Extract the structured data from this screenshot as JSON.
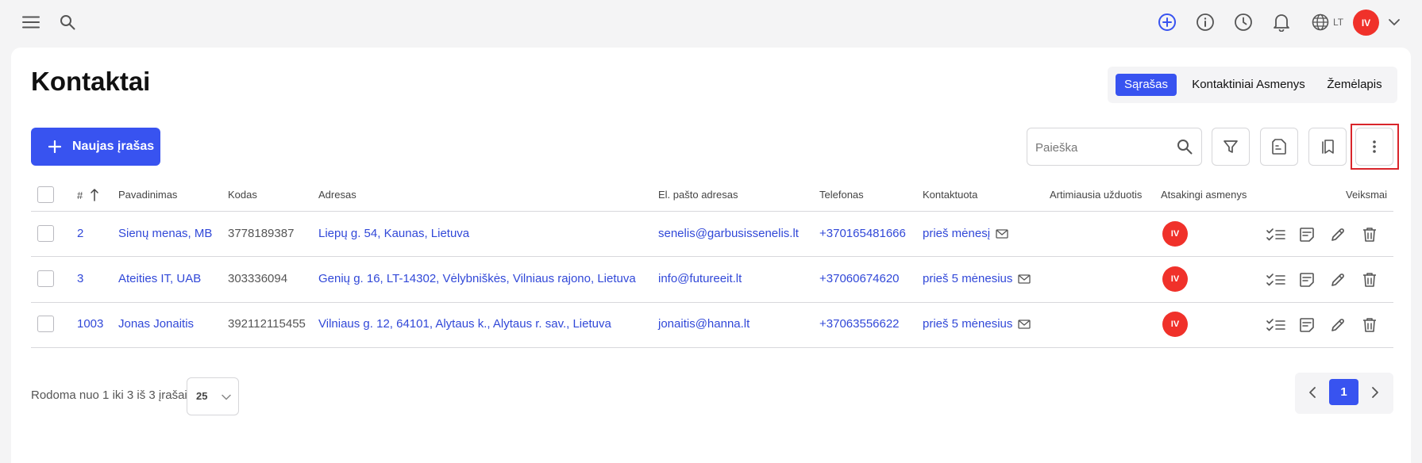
{
  "header": {
    "language": "LT",
    "user_initials": "IV"
  },
  "page": {
    "title": "Kontaktai"
  },
  "view_tabs": [
    {
      "label": "Sąrašas",
      "active": true
    },
    {
      "label": "Kontaktiniai Asmenys",
      "active": false
    },
    {
      "label": "Žemėlapis",
      "active": false
    }
  ],
  "toolbar": {
    "new_record_label": "Naujas įrašas",
    "search_placeholder": "Paieška"
  },
  "table": {
    "columns": [
      "#",
      "Pavadinimas",
      "Kodas",
      "Adresas",
      "El. pašto adresas",
      "Telefonas",
      "Kontaktuota",
      "Artimiausia užduotis",
      "Atsakingi asmenys",
      "Veiksmai"
    ],
    "rows": [
      {
        "id": "2",
        "name": "Sienų menas, MB",
        "code": "3778189387",
        "address": "Liepų g. 54, Kaunas, Lietuva",
        "email": "senelis@garbusissenelis.lt",
        "phone": "+370165481666",
        "contacted": "prieš mėnesį",
        "next_task": "",
        "responsible": "IV"
      },
      {
        "id": "3",
        "name": "Ateities IT, UAB",
        "code": "303336094",
        "address": "Genių g. 16, LT-14302, Vėlybniškės, Vilniaus rajono, Lietuva",
        "email": "info@futureeit.lt",
        "phone": "+37060674620",
        "contacted": "prieš 5 mėnesius",
        "next_task": "",
        "responsible": "IV"
      },
      {
        "id": "1003",
        "name": "Jonas Jonaitis",
        "code": "392112115455",
        "address": "Vilniaus g. 12, 64101, Alytaus k., Alytaus r. sav., Lietuva",
        "email": "jonaitis@hanna.lt",
        "phone": "+37063556622",
        "contacted": "prieš 5 mėnesius",
        "next_task": "",
        "responsible": "IV"
      }
    ]
  },
  "footer": {
    "summary": "Rodoma nuo 1 iki 3 iš 3 įrašai",
    "page_size": "25",
    "current_page": "1"
  },
  "colors": {
    "primary": "#3853f0",
    "link": "#3148d8",
    "avatar": "#f0312a",
    "highlight": "#d9252b"
  }
}
